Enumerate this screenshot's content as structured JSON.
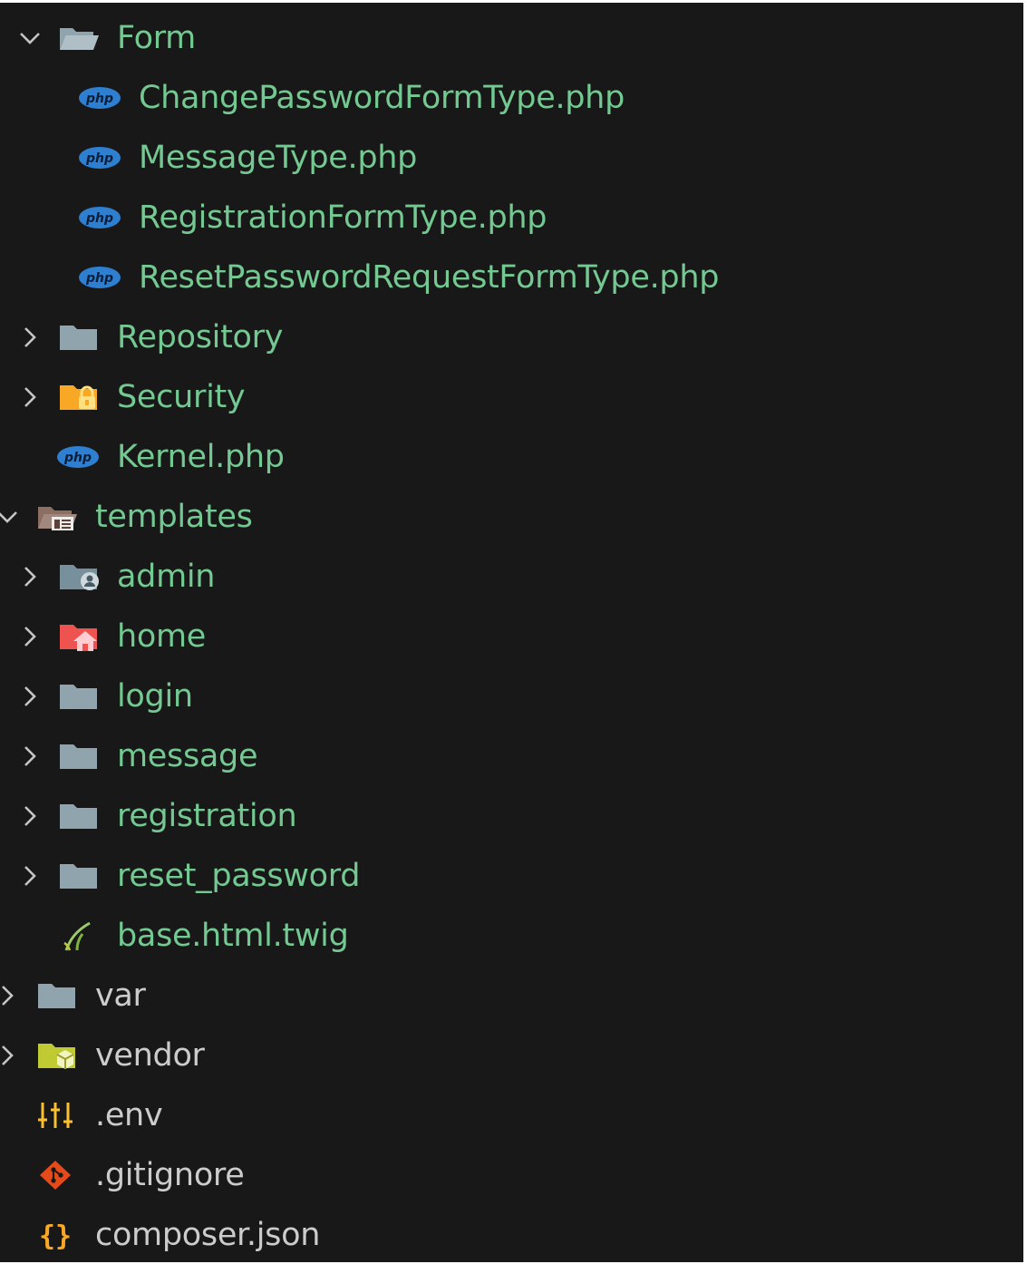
{
  "explorer": {
    "colors": {
      "background": "#181818",
      "label_modified": "#73c991",
      "label_default": "#cccccc"
    },
    "rows": [
      {
        "label": "Form",
        "icon": "folder-open-icon",
        "chevron": "expanded"
      },
      {
        "label": "ChangePasswordFormType.php",
        "icon": "php-icon"
      },
      {
        "label": "MessageType.php",
        "icon": "php-icon"
      },
      {
        "label": "RegistrationFormType.php",
        "icon": "php-icon"
      },
      {
        "label": "ResetPasswordRequestFormType.php",
        "icon": "php-icon"
      },
      {
        "label": "Repository",
        "icon": "folder-icon",
        "chevron": "collapsed"
      },
      {
        "label": "Security",
        "icon": "folder-security-icon",
        "chevron": "collapsed"
      },
      {
        "label": "Kernel.php",
        "icon": "php-icon"
      },
      {
        "label": "templates",
        "icon": "folder-templates-open-icon",
        "chevron": "expanded"
      },
      {
        "label": "admin",
        "icon": "folder-admin-icon",
        "chevron": "collapsed"
      },
      {
        "label": "home",
        "icon": "folder-home-icon",
        "chevron": "collapsed"
      },
      {
        "label": "login",
        "icon": "folder-icon",
        "chevron": "collapsed"
      },
      {
        "label": "message",
        "icon": "folder-icon",
        "chevron": "collapsed"
      },
      {
        "label": "registration",
        "icon": "folder-icon",
        "chevron": "collapsed"
      },
      {
        "label": "reset_password",
        "icon": "folder-icon",
        "chevron": "collapsed"
      },
      {
        "label": "base.html.twig",
        "icon": "twig-icon"
      },
      {
        "label": "var",
        "icon": "folder-icon",
        "chevron": "collapsed"
      },
      {
        "label": "vendor",
        "icon": "folder-vendor-icon",
        "chevron": "collapsed"
      },
      {
        "label": ".env",
        "icon": "env-settings-icon"
      },
      {
        "label": ".gitignore",
        "icon": "git-icon"
      },
      {
        "label": "composer.json",
        "icon": "json-braces-icon"
      }
    ]
  }
}
